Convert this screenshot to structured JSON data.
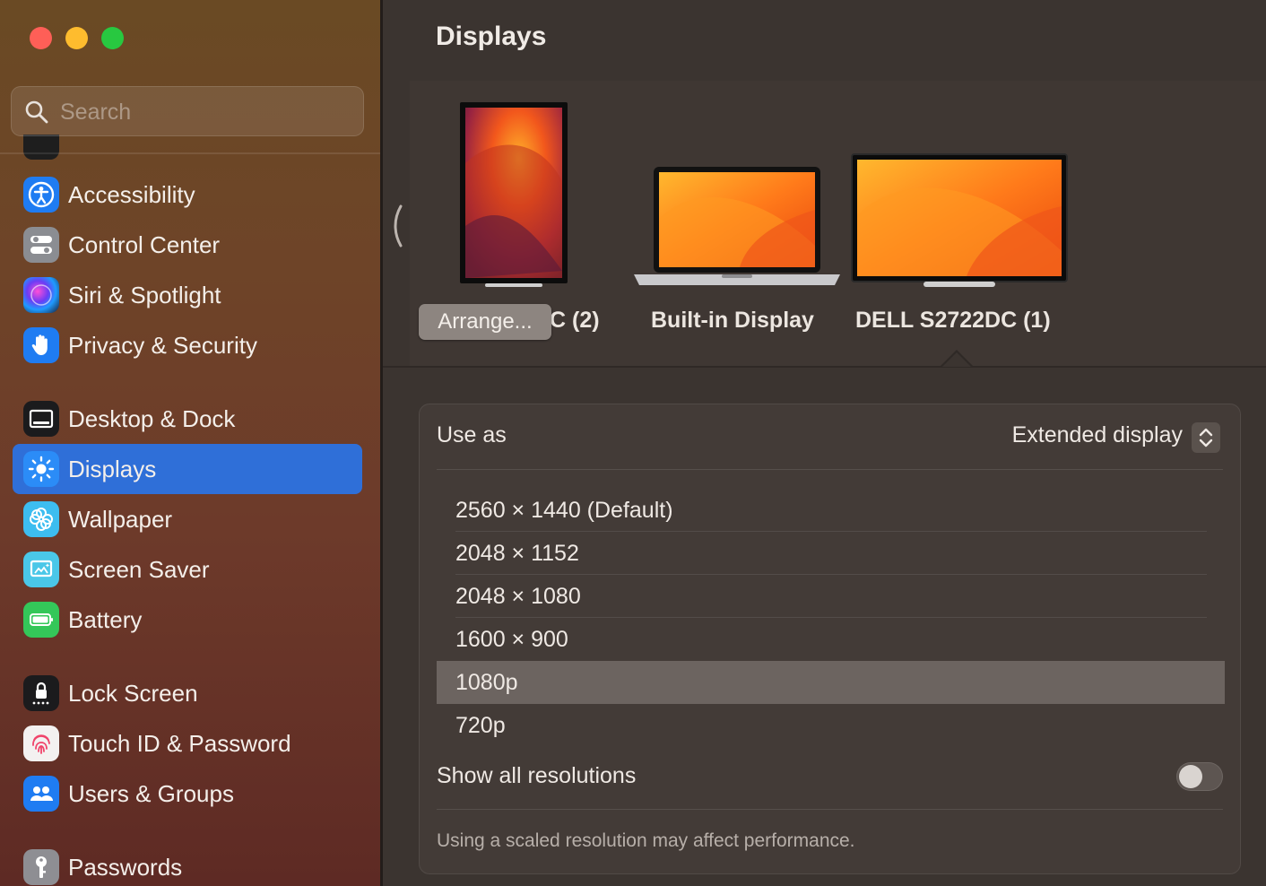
{
  "window": {
    "title": "Displays"
  },
  "search": {
    "placeholder": "Search"
  },
  "sidebar": {
    "items": [
      {
        "label": "Accessibility",
        "icon": "accessibility-icon"
      },
      {
        "label": "Control Center",
        "icon": "control-center-icon"
      },
      {
        "label": "Siri & Spotlight",
        "icon": "siri-icon"
      },
      {
        "label": "Privacy & Security",
        "icon": "hand-icon"
      },
      {
        "label": "Desktop & Dock",
        "icon": "dock-icon"
      },
      {
        "label": "Displays",
        "icon": "sun-icon",
        "selected": true
      },
      {
        "label": "Wallpaper",
        "icon": "flower-icon"
      },
      {
        "label": "Screen Saver",
        "icon": "screen-saver-icon"
      },
      {
        "label": "Battery",
        "icon": "battery-icon"
      },
      {
        "label": "Lock Screen",
        "icon": "lock-icon"
      },
      {
        "label": "Touch ID & Password",
        "icon": "fingerprint-icon"
      },
      {
        "label": "Users & Groups",
        "icon": "users-icon"
      },
      {
        "label": "Passwords",
        "icon": "key-icon"
      }
    ]
  },
  "arrangement": {
    "arrange_button": "Arrange...",
    "displays": [
      {
        "label": "DELL S2722DC (2)",
        "visible_label": "C (2)"
      },
      {
        "label": "Built-in Display"
      },
      {
        "label": "DELL S2722DC (1)",
        "selected": true
      }
    ]
  },
  "settings": {
    "use_as_label": "Use as",
    "use_as_value": "Extended display",
    "resolutions": [
      "2560 × 1440 (Default)",
      "2048 × 1152",
      "2048 × 1080",
      "1600 × 900",
      "1080p",
      "720p"
    ],
    "selected_resolution": "1080p",
    "show_all_label": "Show all resolutions",
    "show_all_enabled": false,
    "footnote": "Using a scaled resolution may affect performance."
  },
  "colors": {
    "accent": "#2f6fd8",
    "traffic_red": "#fe5f57",
    "traffic_yellow": "#febc2e",
    "traffic_green": "#28c840"
  }
}
